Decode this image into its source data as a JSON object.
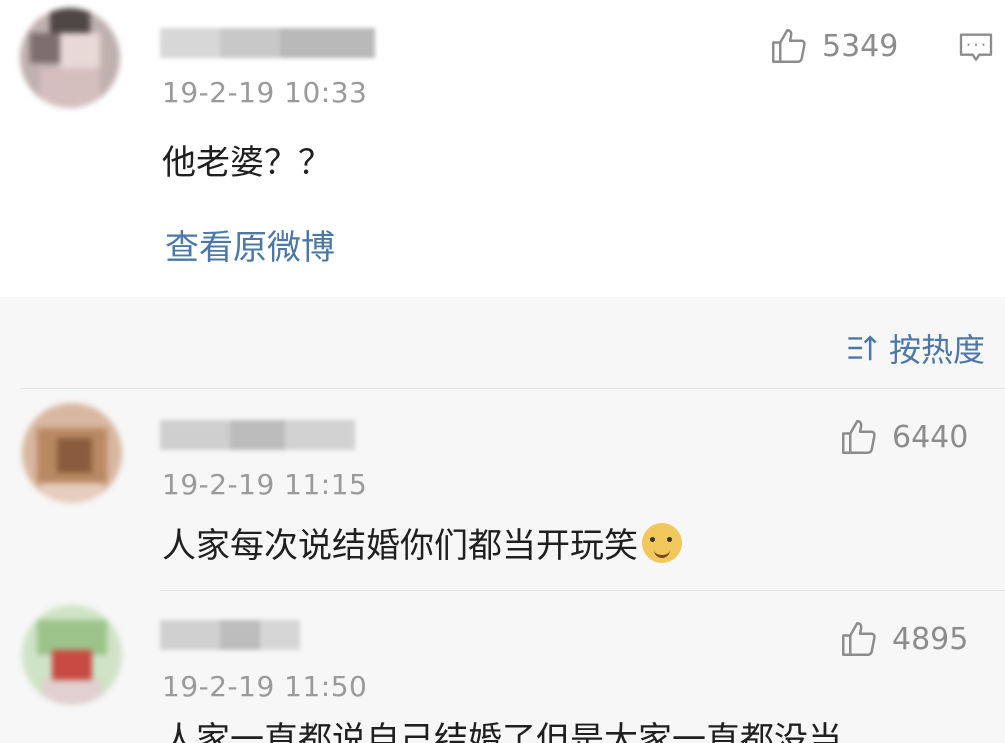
{
  "original_comment": {
    "avatar_colors": [
      "#9a8f8f",
      "#c9b6b6",
      "#6d6060",
      "#e8d7d4",
      "#b79a9a",
      "#d8c5c2"
    ],
    "timestamp": "19-2-19 10:33",
    "text": "他老婆？？",
    "likes": "5349",
    "view_original_label": "查看原微博",
    "icons": {
      "like": "thumbs-up-icon",
      "comment": "comment-icon"
    }
  },
  "sort": {
    "label": "按热度",
    "icon": "sort-icon"
  },
  "replies": [
    {
      "timestamp": "19-2-19 11:15",
      "text": "人家每次说结婚你们都当开玩笑",
      "emoji": "doge-emoji",
      "likes": "6440"
    },
    {
      "timestamp": "19-2-19 11:50",
      "text": "人家一直都说自己结婚了但是大家一直都没当",
      "likes": "4895"
    }
  ],
  "colors": {
    "link": "#4c78a6",
    "meta": "#9a9a9a",
    "background": "#f7f7f7"
  }
}
